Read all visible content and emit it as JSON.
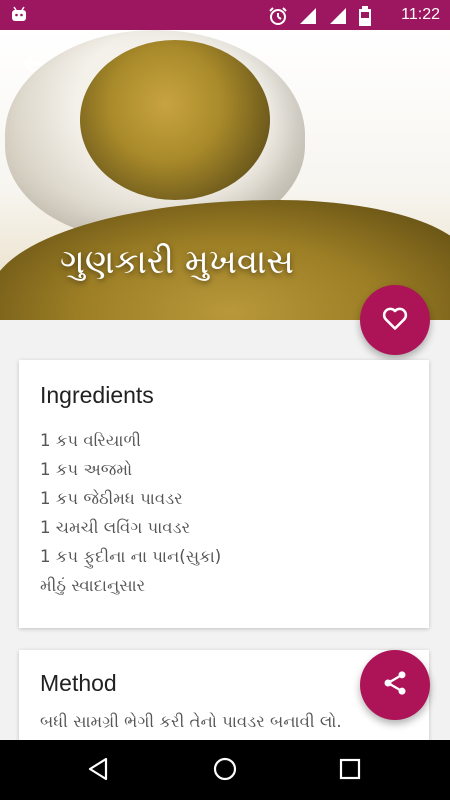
{
  "status_bar": {
    "time": "11:22",
    "icons": [
      "android-icon",
      "alarm-icon",
      "signal-icon",
      "signal-icon",
      "battery-icon"
    ],
    "color": "#9c1760"
  },
  "hero": {
    "title": "ગુણકારી મુખવાસ"
  },
  "ingredients": {
    "heading": "Ingredients",
    "items": [
      "1 કપ વરિયાળી",
      "1 કપ અજમો",
      "1 કપ જેઠીમધ પાવડર",
      "1 ચમચી લવિંગ પાવડર",
      "1 કપ ફુદીના ના પાન(સુકા)",
      "મીઠું સ્વાદાનુસાર"
    ]
  },
  "method": {
    "heading": "Method",
    "text": "બધી સામગ્રી ભેગી કરી તેનો પાવડર બનાવી લો."
  },
  "colors": {
    "accent": "#ad1457",
    "nav_bar": "#000000"
  }
}
